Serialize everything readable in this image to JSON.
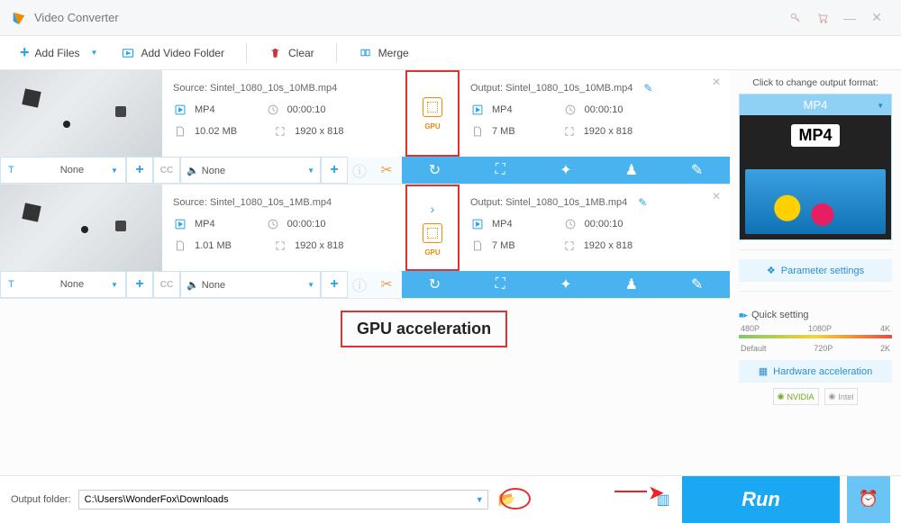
{
  "titlebar": {
    "title": "Video Converter"
  },
  "toolbar": {
    "add_files": "Add Files",
    "add_folder": "Add Video Folder",
    "clear": "Clear",
    "merge": "Merge"
  },
  "items": [
    {
      "source": {
        "name": "Source: Sintel_1080_10s_10MB.mp4",
        "format": "MP4",
        "duration": "00:00:10",
        "size": "10.02 MB",
        "resolution": "1920 x 818"
      },
      "output": {
        "name": "Output: Sintel_1080_10s_10MB.mp4",
        "format": "MP4",
        "duration": "00:00:10",
        "size": "7 MB",
        "resolution": "1920 x 818"
      },
      "text_track": "None",
      "audio_track": "None",
      "gpu_label": "GPU"
    },
    {
      "source": {
        "name": "Source: Sintel_1080_10s_1MB.mp4",
        "format": "MP4",
        "duration": "00:00:10",
        "size": "1.01 MB",
        "resolution": "1920 x 818"
      },
      "output": {
        "name": "Output: Sintel_1080_10s_1MB.mp4",
        "format": "MP4",
        "duration": "00:00:10",
        "size": "7 MB",
        "resolution": "1920 x 818"
      },
      "text_track": "None",
      "audio_track": "None",
      "gpu_label": "GPU"
    }
  ],
  "annotation": "GPU acceleration",
  "side": {
    "title": "Click to change output format:",
    "format": "MP4",
    "badge": "MP4",
    "param_btn": "Parameter settings",
    "quick_title": "Quick setting",
    "scale_top": [
      "480P",
      "1080P",
      "4K"
    ],
    "scale_bot": [
      "Default",
      "720P",
      "2K"
    ],
    "hw_btn": "Hardware acceleration",
    "nvidia": "NVIDIA",
    "intel": "Intel"
  },
  "footer": {
    "label": "Output folder:",
    "path": "C:\\Users\\WonderFox\\Downloads",
    "run": "Run"
  }
}
